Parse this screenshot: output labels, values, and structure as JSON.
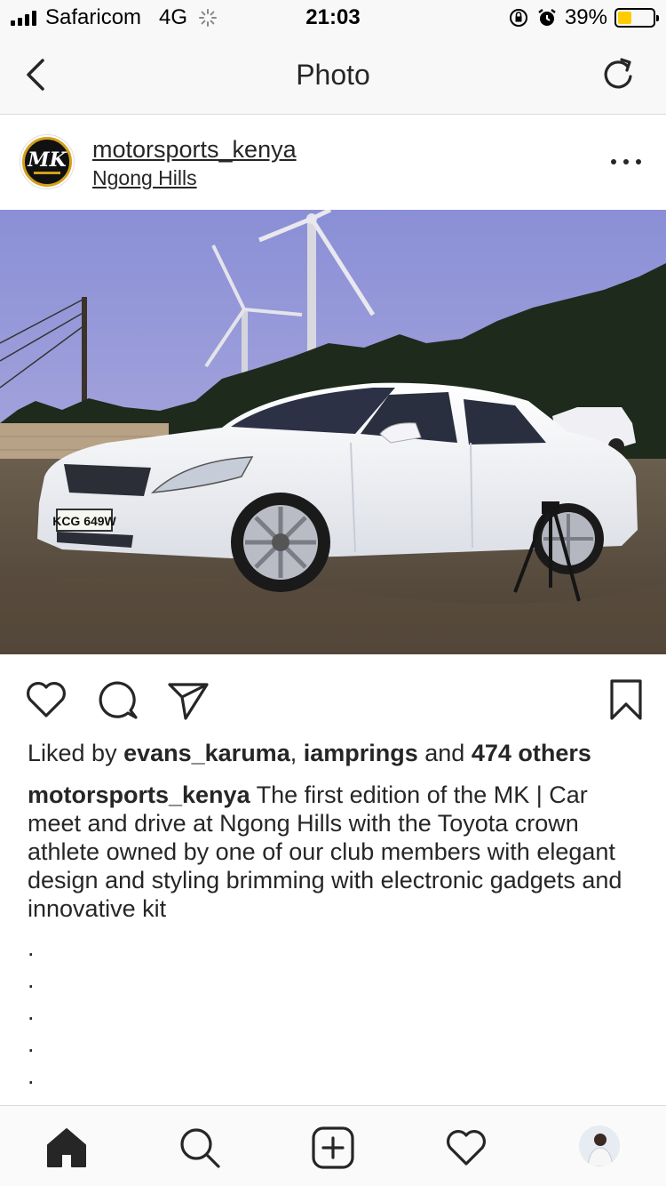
{
  "status_bar": {
    "carrier": "Safaricom",
    "network": "4G",
    "time": "21:03",
    "battery_percent": "39%",
    "battery_level": 0.39,
    "battery_color": "#ffcc00"
  },
  "nav": {
    "title": "Photo",
    "back_icon": "chevron-left-icon",
    "refresh_icon": "refresh-icon"
  },
  "post": {
    "username": "motorsports_kenya",
    "location": "Ngong Hills",
    "avatar_text": "MK",
    "photo_plate": "KCG 649W",
    "likes": {
      "prefix": "Liked by ",
      "user1": "evans_karuma",
      "sep": ", ",
      "user2": "iamprings",
      "and": " and ",
      "others": "474 others"
    },
    "caption_user": "motorsports_kenya",
    "caption_text": " The first edition of the MK | Car meet and drive at Ngong Hills with the Toyota crown athlete owned by one of our club members with elegant design and styling brimming with electronic gadgets and innovative kit",
    "caption_dots": [
      ".",
      ".",
      ".",
      ".",
      "."
    ]
  },
  "actions": [
    "heart-icon",
    "comment-icon",
    "share-icon",
    "bookmark-icon"
  ],
  "tab_bar": [
    "home-icon",
    "search-icon",
    "add-icon",
    "activity-icon",
    "profile-avatar"
  ]
}
